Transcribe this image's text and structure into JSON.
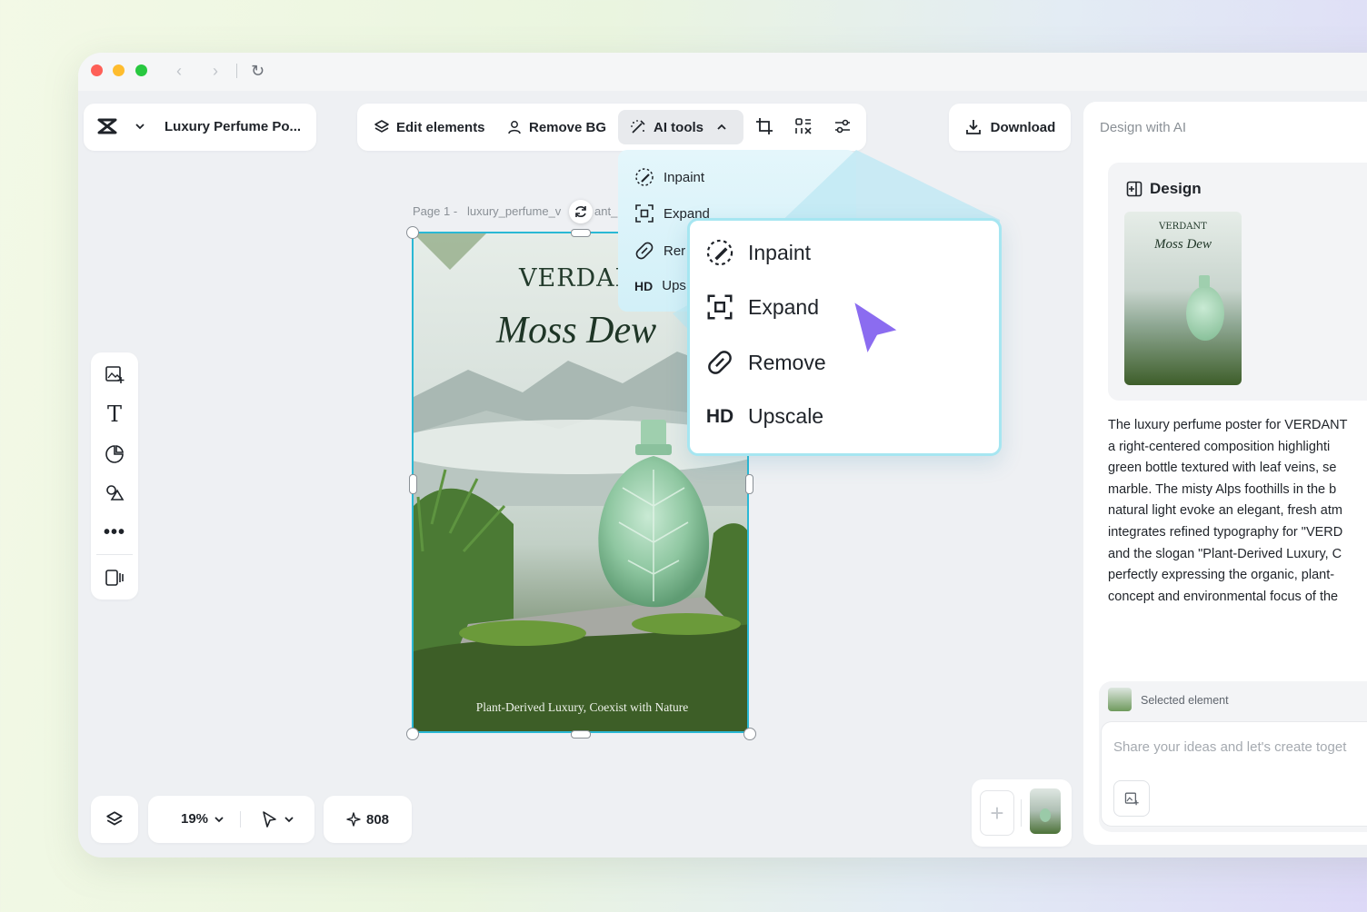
{
  "window": {
    "nav_back": "‹",
    "nav_forward": "›",
    "reload": "↻"
  },
  "app": {
    "document_title": "Luxury Perfume Po..."
  },
  "toolbar": {
    "edit_elements": "Edit elements",
    "remove_bg": "Remove BG",
    "ai_tools": "AI tools",
    "download": "Download"
  },
  "ai_menu_small": {
    "items": [
      "Inpaint",
      "Expand",
      "Rer",
      "Ups"
    ],
    "hd_badge": "HD"
  },
  "ai_menu_large": {
    "items": [
      "Inpaint",
      "Expand",
      "Remove",
      "Upscale"
    ],
    "hd_badge": "HD"
  },
  "canvas": {
    "page_label": "Page 1 -   luxury_perfume_v",
    "page_label_tail": "ant_",
    "poster": {
      "brand": "VERDANT",
      "title": "Moss Dew",
      "slogan": "Plant-Derived Luxury, Coexist with Nature"
    }
  },
  "bottom_bar": {
    "zoom": "19%",
    "credits": "808"
  },
  "right_panel": {
    "header": "Design with AI",
    "design_label": "Design",
    "thumb_brand": "VERDANT",
    "thumb_title": "Moss Dew",
    "description_lines": [
      "The luxury perfume poster for VERDANT",
      "a right-centered composition highlighti",
      "green bottle textured with leaf veins, se",
      "marble. The misty Alps foothills in the b",
      "natural light evoke an elegant, fresh atm",
      "integrates refined typography for \"VERD",
      "and the slogan \"Plant-Derived Luxury, C",
      "perfectly expressing the organic, plant-",
      "concept and environmental focus of the"
    ],
    "selected_element": "Selected element",
    "prompt_placeholder": "Share your ideas and let's create toget"
  },
  "colors": {
    "accent_cyan": "#2ab8d4",
    "cursor_purple": "#8b6cf0",
    "traffic_red": "#fe5f57",
    "traffic_yellow": "#febc2e",
    "traffic_green": "#28c840"
  },
  "icons": {
    "app_logo": "capcut-logo-icon",
    "cursor": "pointer-cursor-icon"
  }
}
